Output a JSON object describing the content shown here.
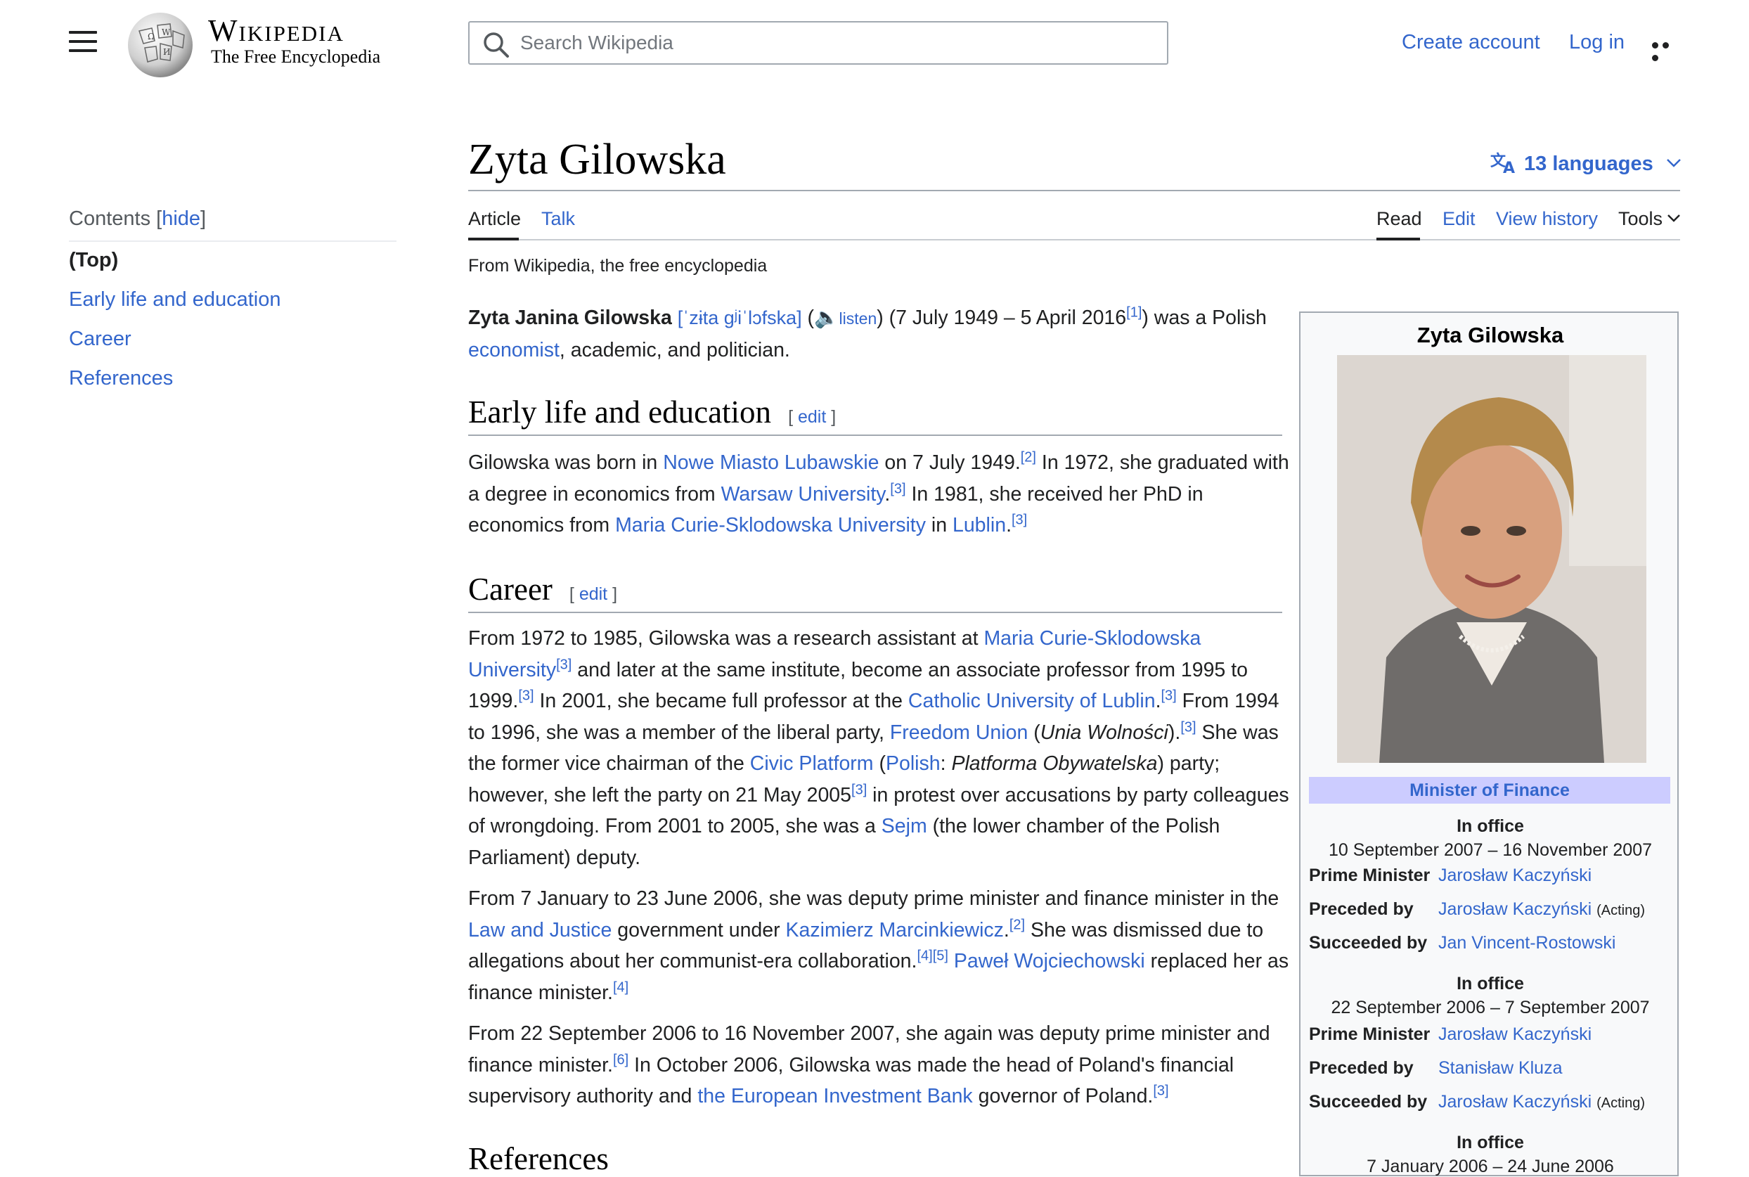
{
  "header": {
    "wordmark": "Wikipedia",
    "tagline": "The Free Encyclopedia",
    "search_placeholder": "Search Wikipedia",
    "create_account": "Create account",
    "log_in": "Log in"
  },
  "toc": {
    "title": "Contents",
    "hide": "hide",
    "items": [
      "(Top)",
      "Early life and education",
      "Career",
      "References"
    ]
  },
  "article": {
    "title": "Zyta Gilowska",
    "languages": "13 languages",
    "tabs": [
      "Article",
      "Talk"
    ],
    "actions": [
      "Read",
      "Edit",
      "View history",
      "Tools"
    ],
    "tagline": "From Wikipedia, the free encyclopedia",
    "sections": [
      "Early life and education",
      "Career",
      "References"
    ],
    "edit_label": "edit"
  },
  "infobox": {
    "title": "Zyta Gilowska",
    "office": "Minister of Finance",
    "in_office": "In office",
    "terms": [
      {
        "dates": "10 September 2007 – 16 November 2007",
        "pm": "Jarosław Kaczyński",
        "preceded": "Jarosław Kaczyński",
        "preceded_note": "(Acting)",
        "succeeded": "Jan Vincent-Rostowski",
        "succeeded_note": ""
      },
      {
        "dates": "22 September 2006 – 7 September 2007",
        "pm": "Jarosław Kaczyński",
        "preceded": "Stanisław Kluza",
        "preceded_note": "",
        "succeeded": "Jarosław Kaczyński",
        "succeeded_note": "(Acting)"
      },
      {
        "dates": "7 January 2006 – 24 June 2006"
      }
    ],
    "labels": {
      "pm": "Prime Minister",
      "preceded": "Preceded by",
      "succeeded": "Succeeded by"
    }
  },
  "colors": {
    "link": "#3366cc",
    "office_header": "#ccccff",
    "infobox_bg": "#f8f9fa"
  }
}
